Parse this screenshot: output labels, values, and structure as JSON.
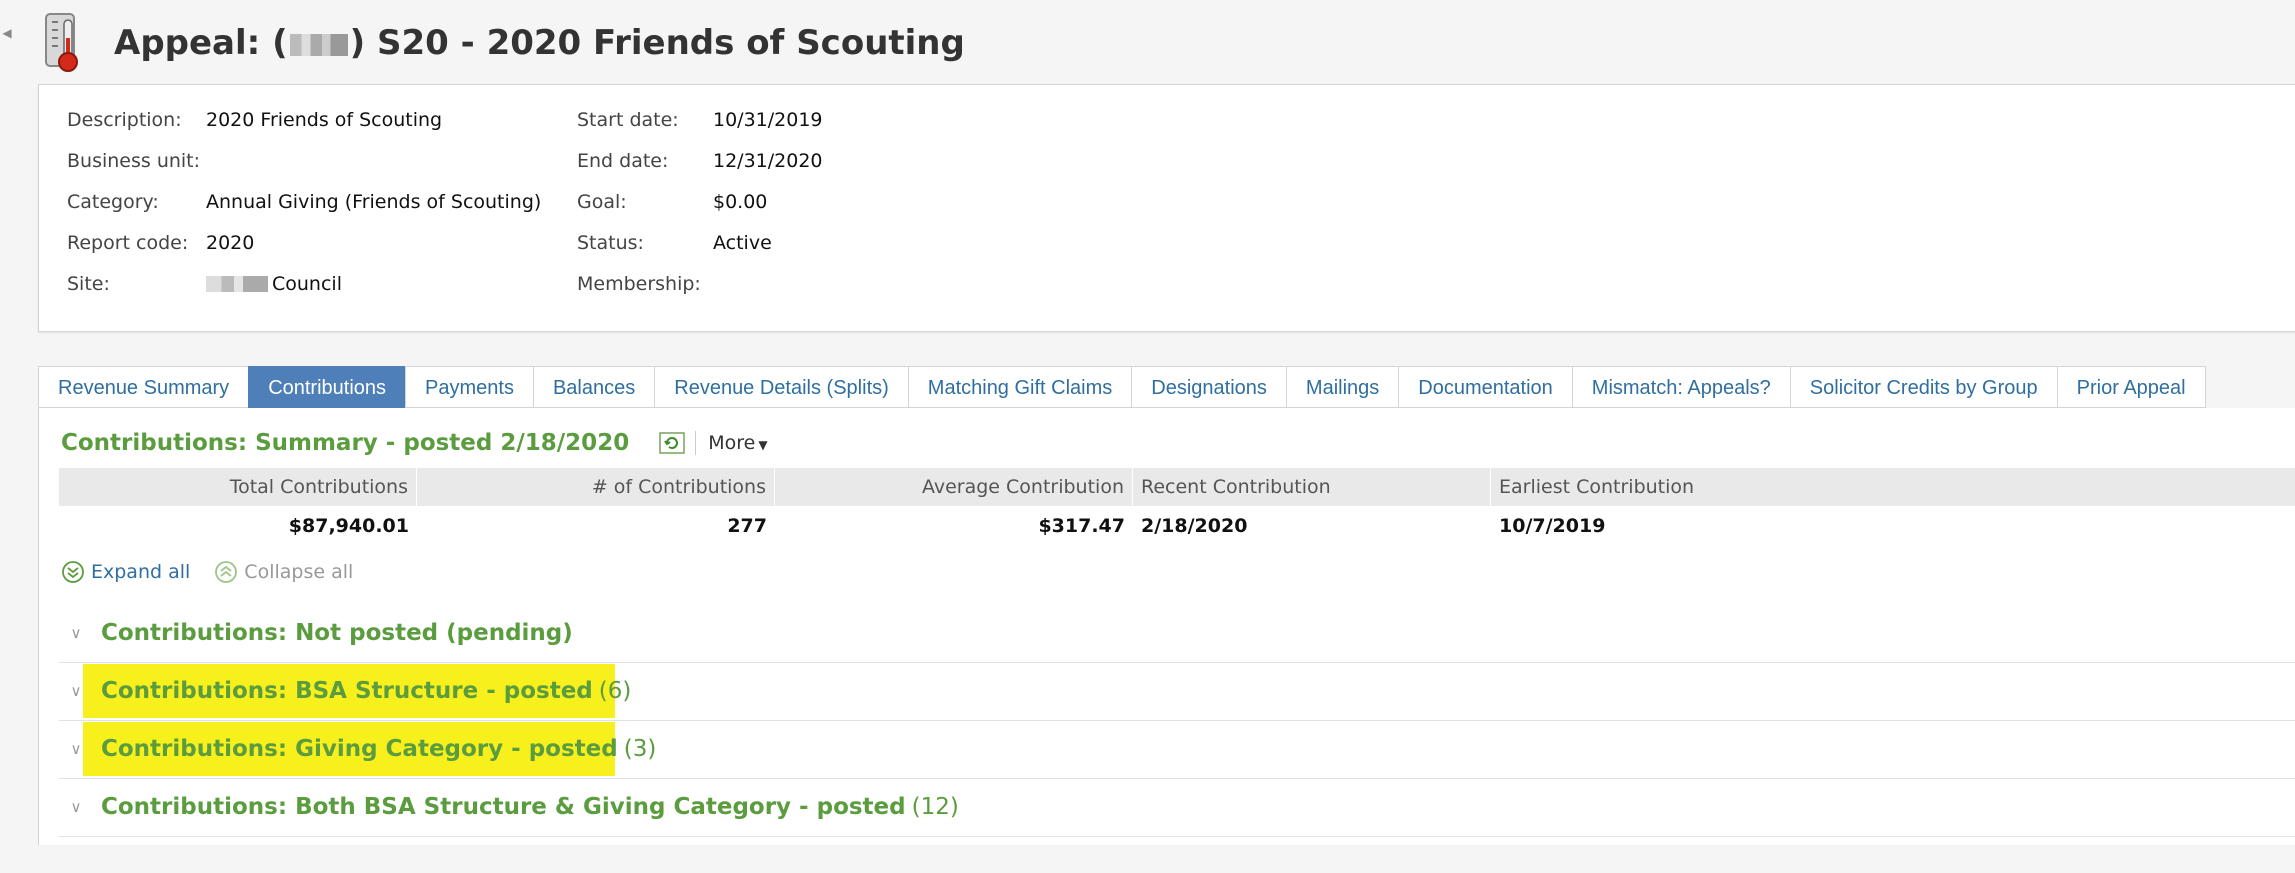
{
  "page": {
    "title_prefix": "Appeal: (",
    "title_suffix": ") S20 - 2020 Friends of Scouting"
  },
  "details": {
    "description_label": "Description:",
    "description_value": "2020 Friends of Scouting",
    "business_unit_label": "Business unit:",
    "business_unit_value": "",
    "category_label": "Category:",
    "category_value": "Annual Giving (Friends of Scouting)",
    "report_code_label": "Report code:",
    "report_code_value": "2020",
    "site_label": "Site:",
    "site_value": "Council",
    "start_date_label": "Start date:",
    "start_date_value": "10/31/2019",
    "end_date_label": "End date:",
    "end_date_value": "12/31/2020",
    "goal_label": "Goal:",
    "goal_value": "$0.00",
    "status_label": "Status:",
    "status_value": "Active",
    "membership_label": "Membership:",
    "membership_value": ""
  },
  "tabs": [
    {
      "label": "Revenue Summary",
      "active": false
    },
    {
      "label": "Contributions",
      "active": true
    },
    {
      "label": "Payments",
      "active": false
    },
    {
      "label": "Balances",
      "active": false
    },
    {
      "label": "Revenue Details (Splits)",
      "active": false
    },
    {
      "label": "Matching Gift Claims",
      "active": false
    },
    {
      "label": "Designations",
      "active": false
    },
    {
      "label": "Mailings",
      "active": false
    },
    {
      "label": "Documentation",
      "active": false
    },
    {
      "label": "Mismatch: Appeals?",
      "active": false
    },
    {
      "label": "Solicitor Credits by Group",
      "active": false
    },
    {
      "label": "Prior Appeal",
      "active": false
    }
  ],
  "summary": {
    "title": "Contributions: Summary - posted 2/18/2020",
    "more_label": "More",
    "headers": [
      "Total Contributions",
      "# of Contributions",
      "Average Contribution",
      "Recent Contribution",
      "Earliest Contribution"
    ],
    "values": [
      "$87,940.01",
      "277",
      "$317.47",
      "2/18/2020",
      "10/7/2019"
    ]
  },
  "controls": {
    "expand_all": "Expand all",
    "collapse_all": "Collapse all"
  },
  "sections": [
    {
      "title": "Contributions: Not posted (pending)",
      "count": "",
      "highlighted": false
    },
    {
      "title": "Contributions: BSA Structure - posted",
      "count": "(6)",
      "highlighted": true
    },
    {
      "title": "Contributions: Giving Category - posted",
      "count": "(3)",
      "highlighted": true
    },
    {
      "title": "Contributions: Both BSA Structure & Giving Category - posted",
      "count": "(12)",
      "highlighted": false
    }
  ],
  "colors": {
    "accent_green": "#5a9c3e",
    "active_tab": "#4e7fb8",
    "link_blue": "#2f6f9f",
    "highlight_yellow": "#f7f01c"
  }
}
